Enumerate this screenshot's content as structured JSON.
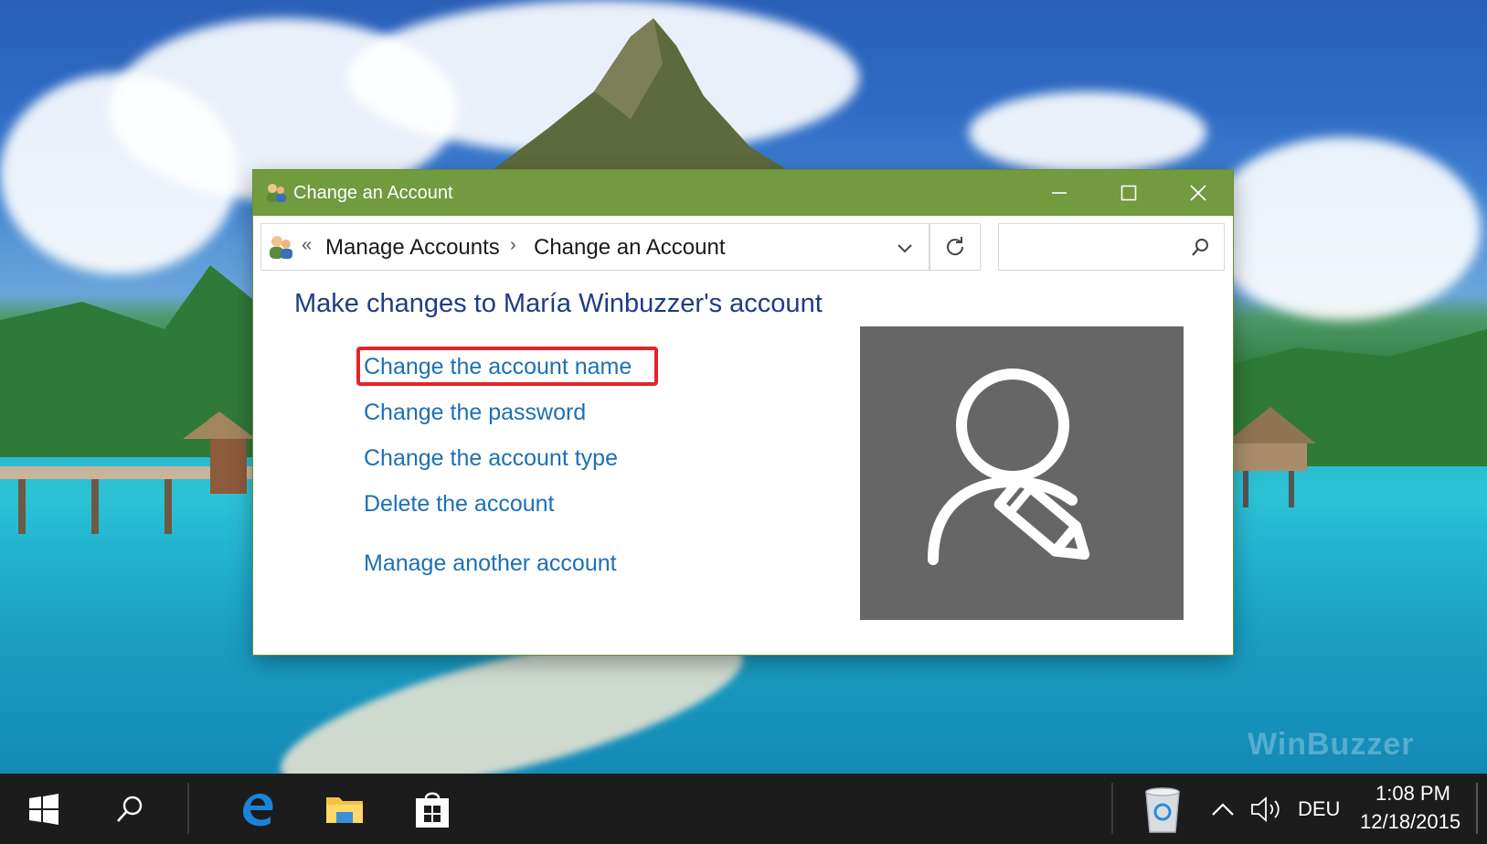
{
  "window": {
    "title": "Change an Account",
    "accent_color": "#729a3f"
  },
  "address_bar": {
    "overflow_chevron": "«",
    "crumbs": [
      "Manage Accounts",
      "Change an Account"
    ],
    "separator": "›",
    "search_placeholder": ""
  },
  "content": {
    "heading": "Make changes to María Winbuzzer's account",
    "links": [
      "Change the account name",
      "Change the password",
      "Change the account type",
      "Delete the account",
      "Manage another account"
    ],
    "highlighted_link": "Change the account name",
    "avatar_icon": "user-edit-icon"
  },
  "taskbar": {
    "language": "DEU",
    "time": "1:08 PM",
    "date": "12/18/2015",
    "pinned": [
      "start-icon",
      "search-icon",
      "edge-icon",
      "file-explorer-icon",
      "store-icon"
    ],
    "tray": [
      "recycle-bin-icon",
      "show-hidden-icons-chevron",
      "volume-icon"
    ]
  },
  "desktop": {
    "watermark": "WinBuzzer"
  }
}
